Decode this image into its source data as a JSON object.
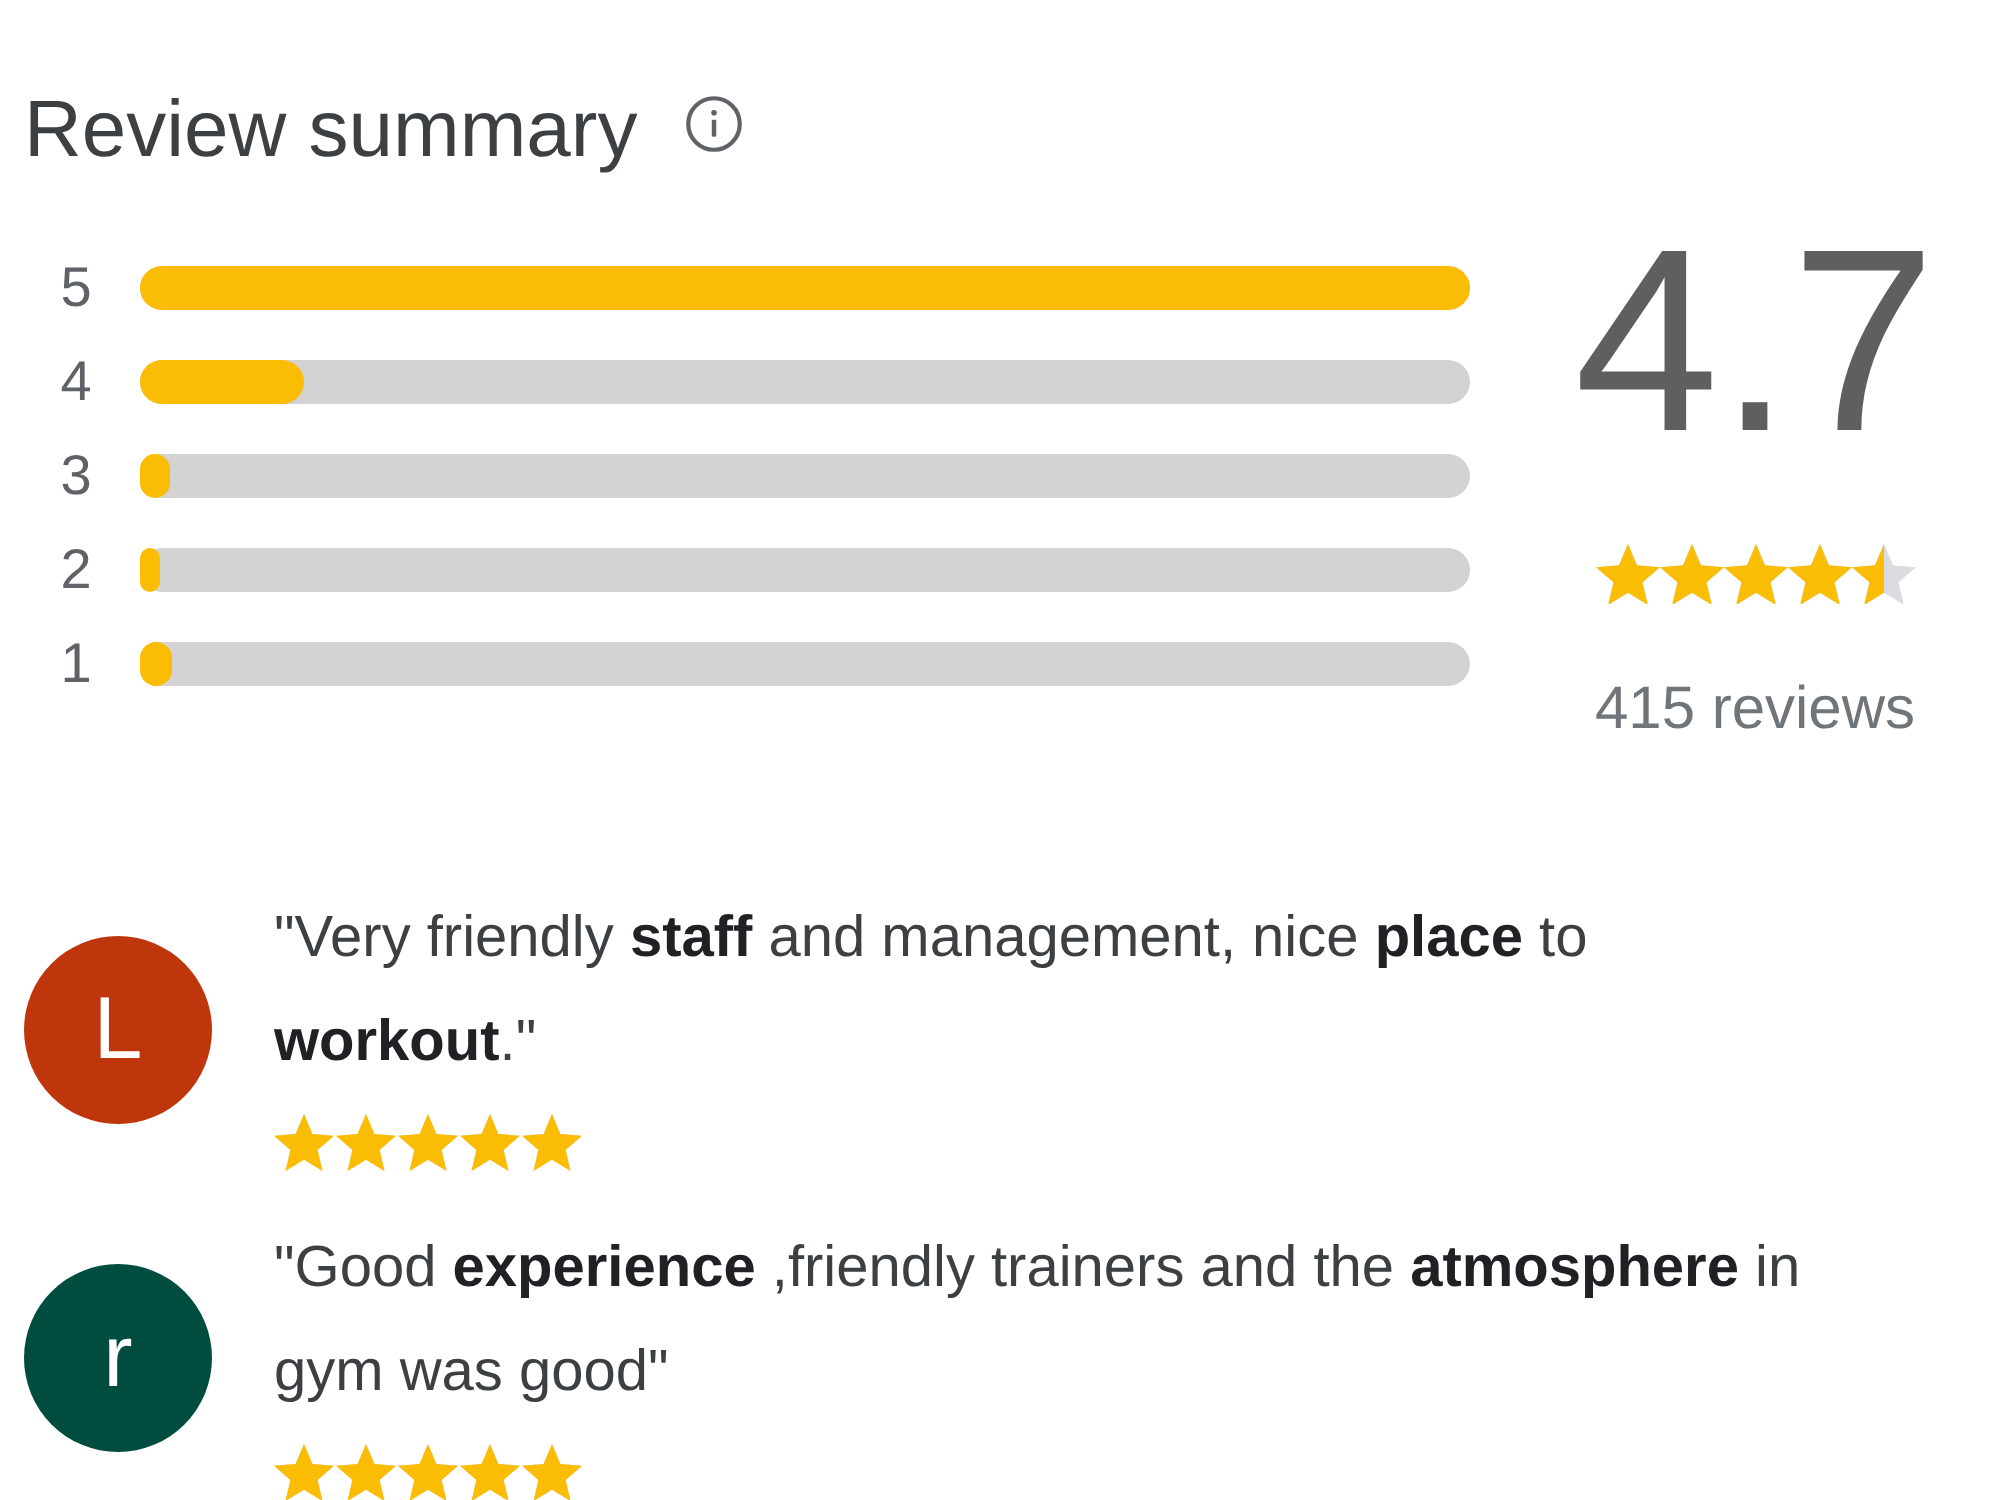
{
  "title": "Review summary",
  "histogram": [
    {
      "label": "5",
      "level": 1.0
    },
    {
      "label": "4",
      "level": 0.123
    },
    {
      "label": "3",
      "level": 0.022
    },
    {
      "label": "2",
      "level": 0.015
    },
    {
      "label": "1",
      "level": 0.024
    }
  ],
  "rating": {
    "value": "4.7",
    "stars": 4.5,
    "count": "415 reviews"
  },
  "reviews": [
    {
      "avatar_letter": "L",
      "color": "#bf360c",
      "text": "\"Very friendly **staff** and management, nice **place** to **workout**.\"",
      "stars": 5
    },
    {
      "avatar_letter": "r",
      "color": "#004d40",
      "text": "\"Good **experience** ,friendly trainers and the **atmosphere** in gym was good\"",
      "stars": 5
    }
  ]
}
